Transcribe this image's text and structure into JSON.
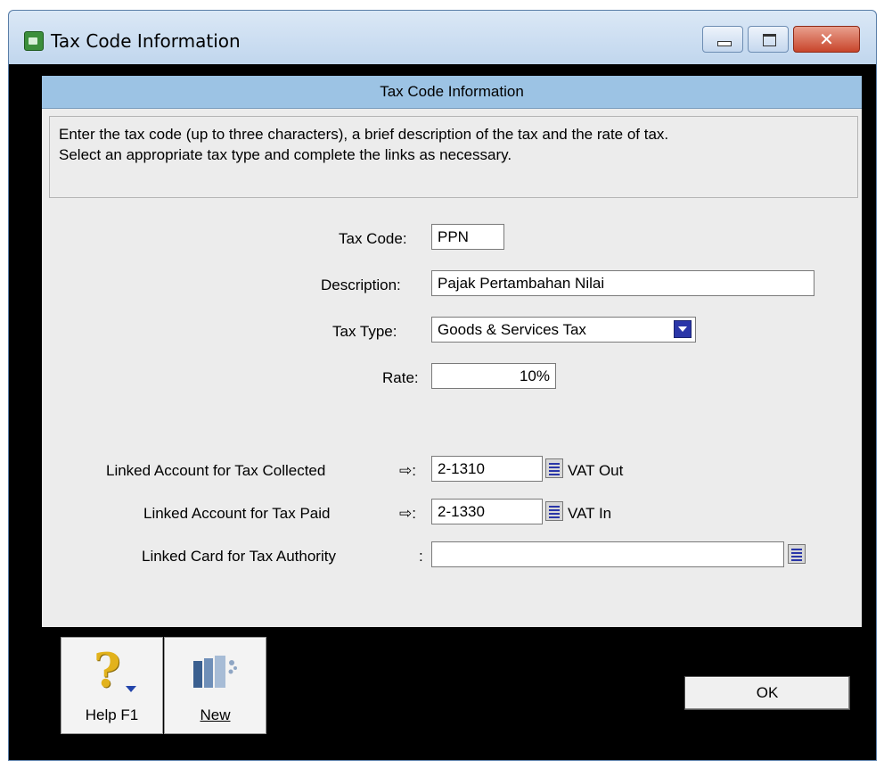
{
  "window": {
    "title": "Tax Code Information",
    "close_glyph": "✕"
  },
  "panel": {
    "header": "Tax Code Information",
    "instructions": [
      "Enter the tax code (up to three characters), a brief description of the tax and the rate of tax.",
      "Select an appropriate tax type and complete the links as necessary."
    ]
  },
  "form": {
    "tax_code_label": "Tax Code:",
    "tax_code_value": "PPN",
    "description_label": "Description:",
    "description_value": "Pajak Pertambahan Nilai",
    "tax_type_label": "Tax Type:",
    "tax_type_value": "Goods & Services Tax",
    "rate_label": "Rate:",
    "rate_value": "10%",
    "collected_label": "Linked Account for Tax Collected",
    "collected_arrow": "⇨:",
    "collected_account": "2-1310",
    "collected_name": "VAT Out",
    "paid_label": "Linked Account for Tax Paid",
    "paid_arrow": "⇨:",
    "paid_account": "2-1330",
    "paid_name": "VAT In",
    "authority_label": "Linked Card for Tax Authority",
    "authority_colon": ":",
    "authority_value": ""
  },
  "buttons": {
    "help_glyph": "?",
    "help_label": "Help F1",
    "new_label": "New",
    "ok_label": "OK"
  }
}
